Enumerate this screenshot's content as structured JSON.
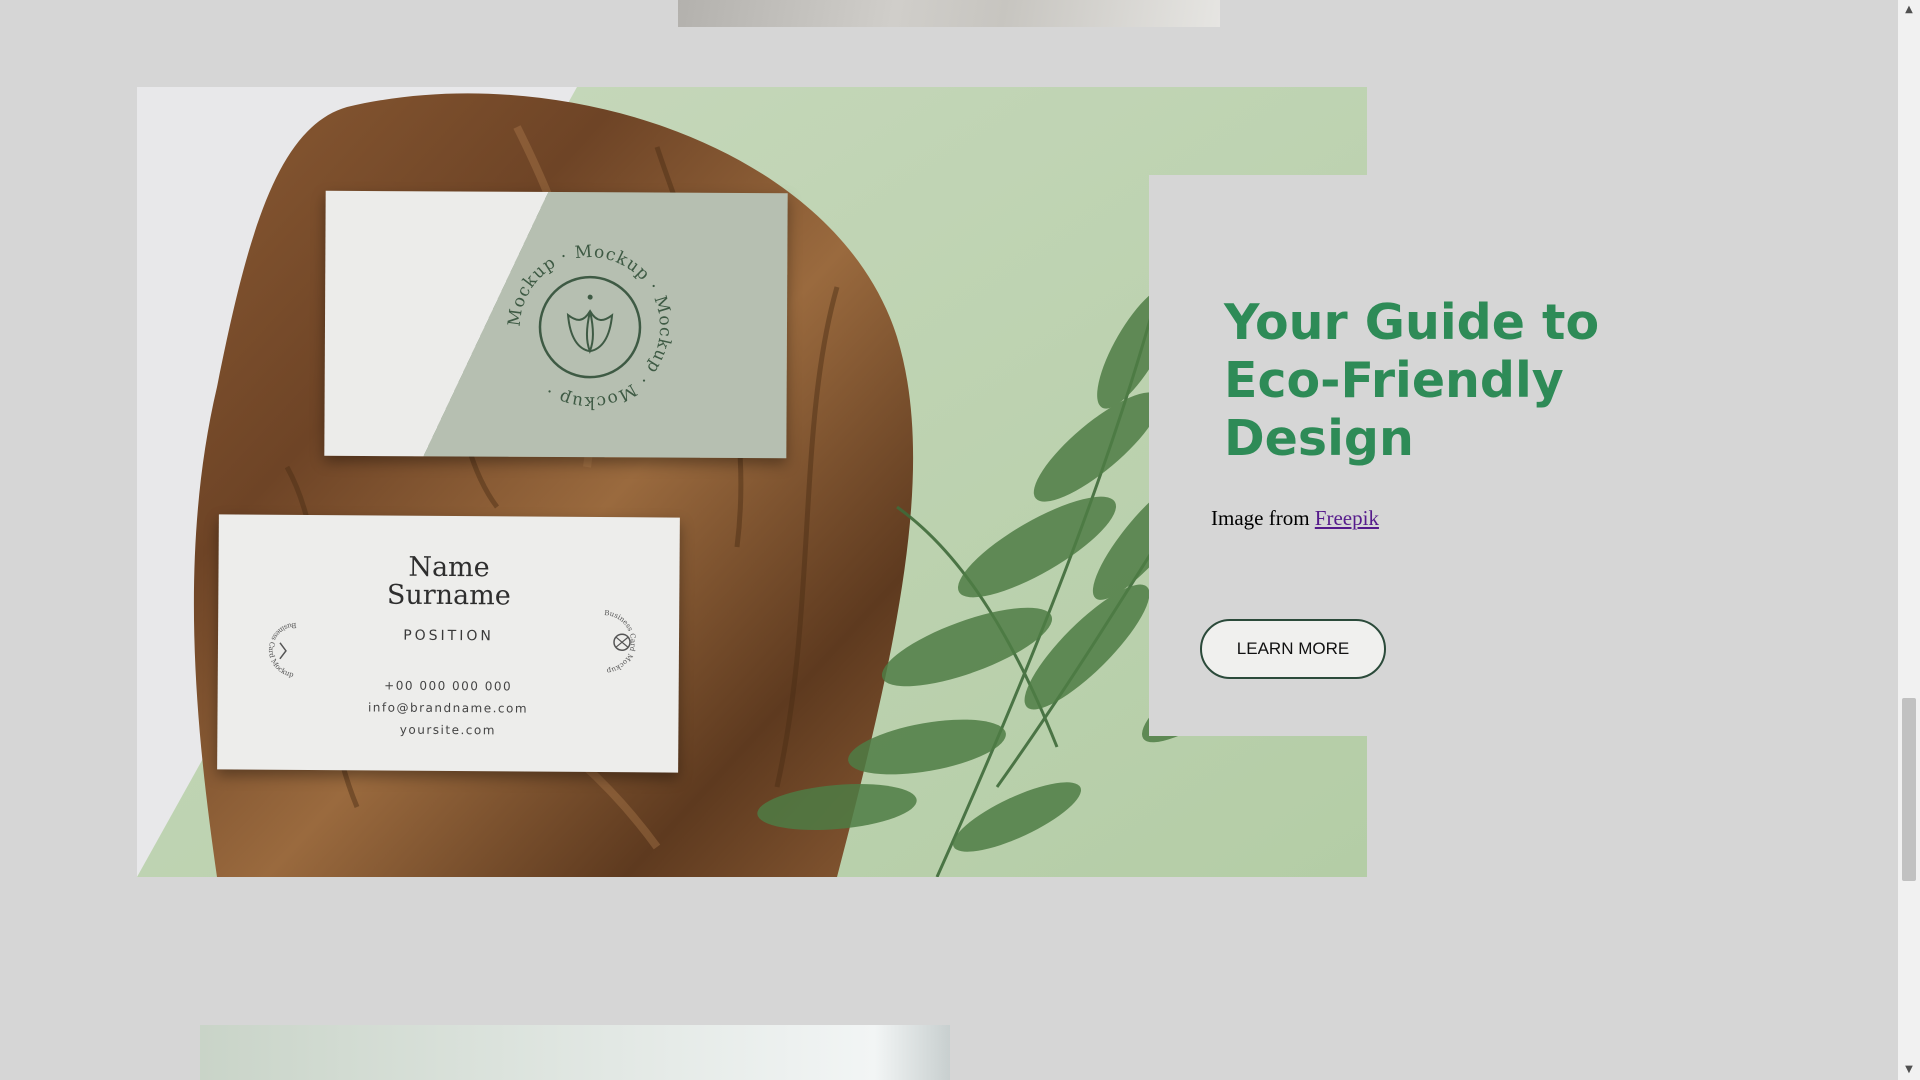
{
  "article": {
    "headline": "Your Guide to Eco-Friendly Design",
    "credit_prefix": "Image from ",
    "credit_link": "Freepik",
    "cta_label": "LEARN MORE"
  },
  "hero_image": {
    "card_name": "Name",
    "card_surname": "Surname",
    "card_position": "POSITION",
    "card_phone": "+00 000 000 000",
    "card_email": "info@brandname.com",
    "card_site": "yoursite.com",
    "ring_text": "Mockup · Mockup · Mockup · Mockup · ",
    "mini_logo_text": "Business Card Mockup"
  },
  "icons": {
    "scroll_up": "triangle-up-icon",
    "scroll_down": "triangle-down-icon",
    "tulip": "tulip-logo-icon"
  },
  "colors": {
    "page_background": "#d6d6d6",
    "headline": "#2e8b57",
    "link": "#551a8b",
    "button_border": "#2b4a3a",
    "hero_background": "#c3d6b5"
  }
}
